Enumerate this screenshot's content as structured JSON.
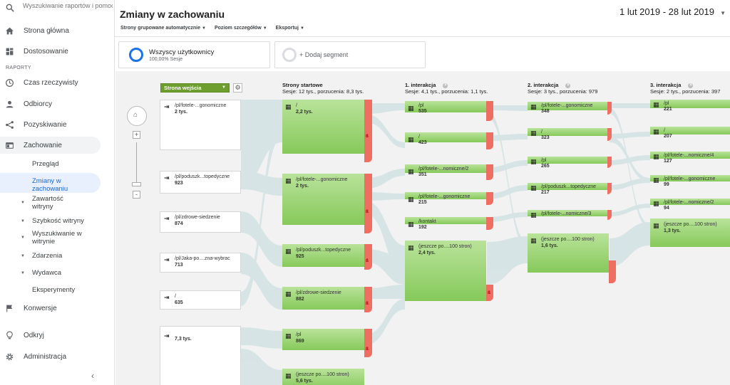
{
  "search": {
    "placeholder": "Wyszukiwanie raportów i pomocy"
  },
  "sidebar": {
    "items_top": [
      {
        "label": "Strona główna",
        "icon": "home-icon"
      },
      {
        "label": "Dostosowanie",
        "icon": "dashboard-icon"
      }
    ],
    "section_label": "RAPORTY",
    "reports": [
      {
        "label": "Czas rzeczywisty",
        "icon": "clock-icon"
      },
      {
        "label": "Odbiorcy",
        "icon": "person-icon"
      },
      {
        "label": "Pozyskiwanie",
        "icon": "acquisition-icon"
      },
      {
        "label": "Zachowanie",
        "icon": "behavior-icon"
      }
    ],
    "behavior_sub": [
      {
        "label": "Przegląd"
      },
      {
        "label": "Zmiany w zachowaniu"
      },
      {
        "label": "Zawartość witryny"
      },
      {
        "label": "Szybkość witryny"
      },
      {
        "label": "Wyszukiwanie w witrynie"
      },
      {
        "label": "Zdarzenia"
      },
      {
        "label": "Wydawca"
      },
      {
        "label": "Eksperymenty"
      }
    ],
    "items_bottom": [
      {
        "label": "Konwersje",
        "icon": "flag-icon"
      },
      {
        "label": "Odkryj",
        "icon": "lightbulb-icon"
      },
      {
        "label": "Administracja",
        "icon": "gear-icon"
      }
    ],
    "collapse_glyph": "‹"
  },
  "header": {
    "title": "Zmiany w zachowaniu",
    "date_range": "1 lut 2019 - 28 lut 2019",
    "toolbar": [
      "Strony grupowane automatycznie",
      "Poziom szczegółów",
      "Eksportuj"
    ]
  },
  "segments": {
    "all_users": {
      "title": "Wszyscy użytkownicy",
      "subtitle": "100,00% Sesje"
    },
    "add": {
      "label": "+ Dodaj segment"
    }
  },
  "flow": {
    "entry_selector": "Strona wejścia",
    "columns": [
      {
        "title": "Strony startowe",
        "stats": "Sesje: 12 tys., porzucenia: 8,3 tys."
      },
      {
        "title": "1. interakcja",
        "stats": "Sesje: 4,1 tys., porzucenia: 1,1 tys."
      },
      {
        "title": "2. interakcja",
        "stats": "Sesje: 3 tys., porzucenia: 979"
      },
      {
        "title": "3. interakcja",
        "stats": "Sesje: 2 tys., porzucenia: 397"
      }
    ],
    "sources": [
      {
        "name": "/pl/fotele-...gonomiczne",
        "value": "2 tys."
      },
      {
        "name": "/pl/poduszk...topedyczne",
        "value": "923"
      },
      {
        "name": "/pl/zdrowe-siedzenie",
        "value": "874"
      },
      {
        "name": "/pl/Jaka-po....zna-wybrac",
        "value": "713"
      },
      {
        "name": "/",
        "value": "635"
      },
      {
        "name": "",
        "value": "7,3 tys."
      }
    ],
    "start_pages": [
      {
        "name": "/",
        "value": "2,2 tys."
      },
      {
        "name": "/pl/fotele-...gonomiczne",
        "value": "2 tys."
      },
      {
        "name": "/pl/poduszk...topedyczne",
        "value": "925"
      },
      {
        "name": "/pl/zdrowe-siedzenie",
        "value": "882"
      },
      {
        "name": "/pl",
        "value": "869"
      },
      {
        "name": "(jeszcze po....100 stron)",
        "value": "5,6 tys."
      }
    ],
    "interaction1": [
      {
        "name": "/pl",
        "value": "535"
      },
      {
        "name": "/",
        "value": "423"
      },
      {
        "name": "/pl/fotele-...nomiczne/2",
        "value": "351"
      },
      {
        "name": "/pl/fotele-...gonomiczne",
        "value": "215"
      },
      {
        "name": "/kontakt",
        "value": "192"
      },
      {
        "name": "(jeszcze po....100 stron)",
        "value": "2,4 tys."
      }
    ],
    "interaction2": [
      {
        "name": "/pl/fotele-...gonomiczne",
        "value": "348"
      },
      {
        "name": "/",
        "value": "323"
      },
      {
        "name": "/pl",
        "value": "265"
      },
      {
        "name": "/pl/poduszk...topedyczne",
        "value": "217"
      },
      {
        "name": "/pl/fotele-...nomiczne/3",
        "value": ""
      },
      {
        "name": "(jeszcze po....100 stron)",
        "value": "1,6 tys."
      }
    ],
    "interaction3": [
      {
        "name": "/pl",
        "value": "221"
      },
      {
        "name": "/",
        "value": "207"
      },
      {
        "name": "/pl/fotele-...nomiczne/4",
        "value": "127"
      },
      {
        "name": "/pl/fotele-...gonomiczne",
        "value": "99"
      },
      {
        "name": "/pl/fotele-...nomiczne/2",
        "value": "94"
      },
      {
        "name": "(jeszcze po....100 stron)",
        "value": "1,3 tys."
      }
    ],
    "node_icon": "page-icon",
    "colors": {
      "node": "#8fcd63",
      "dropoff": "#ef6e62",
      "band": "#d3e2e4",
      "entry": "#6d9e2e"
    }
  }
}
